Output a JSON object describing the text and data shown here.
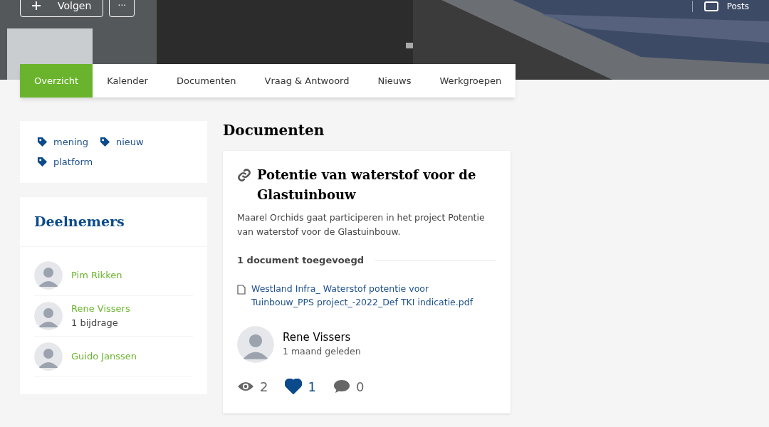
{
  "header": {
    "follow_button": "Volgen",
    "more_button": "···",
    "posts_label": "Posts"
  },
  "tabs": [
    {
      "label": "Overzicht",
      "selected": true
    },
    {
      "label": "Kalender",
      "selected": false
    },
    {
      "label": "Documenten",
      "selected": false
    },
    {
      "label": "Vraag & Antwoord",
      "selected": false
    },
    {
      "label": "Nieuws",
      "selected": false
    },
    {
      "label": "Werkgroepen",
      "selected": false
    }
  ],
  "tags": [
    "mening",
    "nieuw",
    "platform"
  ],
  "participants": {
    "title": "Deelnemers",
    "items": [
      {
        "name": "Pim Rikken"
      },
      {
        "name": "Rene Vissers",
        "note": "1 bijdrage"
      },
      {
        "name": "Guido Janssen"
      }
    ]
  },
  "section_title": "Documenten",
  "post": {
    "title": "Potentie van waterstof voor de Glastuinbouw",
    "body": "Maarel Orchids gaat participeren in het project Potentie van waterstof voor de Glastuinbouw.",
    "attachments_label": "1 document toegevoegd",
    "attachment": "Westland Infra_ Waterstof potentie voor Tuinbouw_PPS project_-2022_Def TKI indicatie.pdf",
    "author": "Rene Vissers",
    "time": "1 maand geleden",
    "views": "2",
    "likes": "1",
    "liked": true,
    "comments": "0"
  }
}
